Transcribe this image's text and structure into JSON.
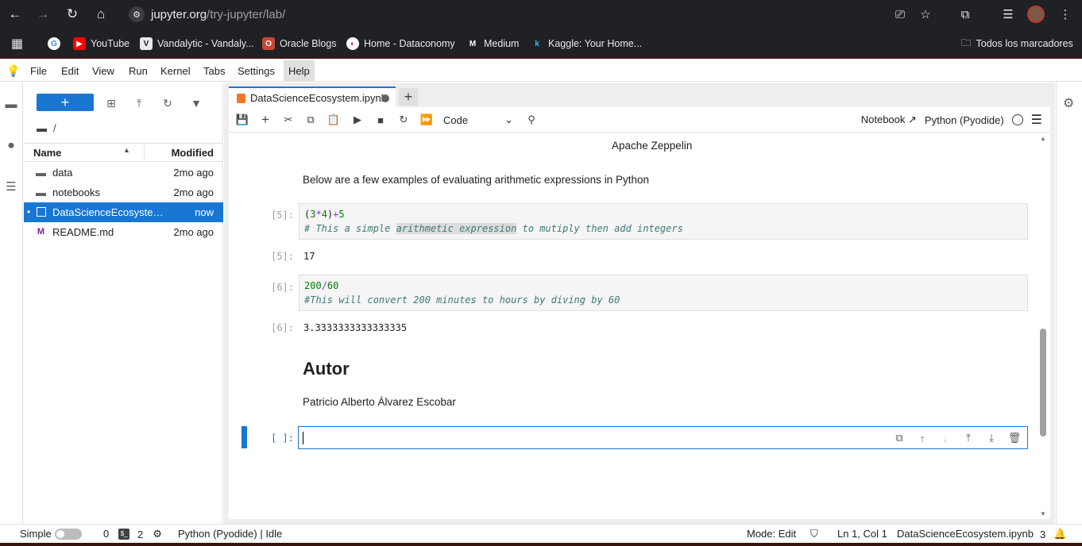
{
  "browser": {
    "url_host": "jupyter.org",
    "url_path": "/try-jupyter/lab/",
    "bookmarks": [
      {
        "label": "YouTube",
        "icon": "youtube-icon",
        "color": "#ff0000"
      },
      {
        "label": "Vandalytic - Vandaly...",
        "icon": "vandalytic-icon",
        "color": "#333333"
      },
      {
        "label": "Oracle Blogs",
        "icon": "oracle-icon",
        "color": "#c74634"
      },
      {
        "label": "Home - Dataconomy",
        "icon": "dataconomy-icon",
        "color": "#e8eaed"
      },
      {
        "label": "Medium",
        "icon": "medium-icon",
        "color": "#000000"
      },
      {
        "label": "Kaggle: Your Home...",
        "icon": "kaggle-icon",
        "color": "#20beff"
      }
    ],
    "all_bookmarks": "Todos los marcadores"
  },
  "menubar": {
    "items": [
      "File",
      "Edit",
      "View",
      "Run",
      "Kernel",
      "Tabs",
      "Settings",
      "Help"
    ]
  },
  "filebrowser": {
    "path": "/",
    "col_name": "Name",
    "col_modified": "Modified",
    "rows": [
      {
        "name": "data",
        "modified": "2mo ago",
        "type": "folder"
      },
      {
        "name": "notebooks",
        "modified": "2mo ago",
        "type": "folder"
      },
      {
        "name": "DataScienceEcosystem.ipynb",
        "modified": "now",
        "type": "notebook"
      },
      {
        "name": "README.md",
        "modified": "2mo ago",
        "type": "markdown"
      }
    ]
  },
  "notebook": {
    "tab_title": "DataScienceEcosystem.ipynb",
    "cell_type": "Code",
    "notebook_label": "Notebook",
    "kernel_name": "Python (Pyodide)",
    "cells": {
      "md_top": "Apache Zeppelin",
      "md_examples": "Below are a few examples of evaluating arithmetic expressions in Python",
      "c5_prompt": "[5]:",
      "c5_line1_a": "(",
      "c5_line1_b": "3",
      "c5_line1_c": "*",
      "c5_line1_d": "4",
      "c5_line1_e": ")",
      "c5_line1_f": "+",
      "c5_line1_g": "5",
      "c5_comment_a": "# This a simple ",
      "c5_comment_b": "arithmetic expression",
      "c5_comment_c": " to mutiply then add integers",
      "c5_out_prompt": "[5]:",
      "c5_out": "17",
      "c6_prompt": "[6]:",
      "c6_line1_a": "200",
      "c6_line1_b": "/",
      "c6_line1_c": "60",
      "c6_comment": "#This will convert 200 minutes to hours by diving by 60",
      "c6_out_prompt": "[6]:",
      "c6_out": "3.3333333333333335",
      "md_heading": "Autor",
      "md_author": "Patricio Alberto Álvarez Escobar",
      "active_prompt": "[ ]:"
    }
  },
  "statusbar": {
    "mode_label": "Simple",
    "terminals": "0",
    "kernels": "2",
    "kernel_status": "Python (Pyodide) | Idle",
    "edit_mode": "Mode: Edit",
    "cursor": "Ln 1, Col 1",
    "filename": "DataScienceEcosystem.ipynb",
    "notifications": "3"
  },
  "colors": {
    "accent": "#1976d2",
    "chrome_bg": "#202124"
  }
}
